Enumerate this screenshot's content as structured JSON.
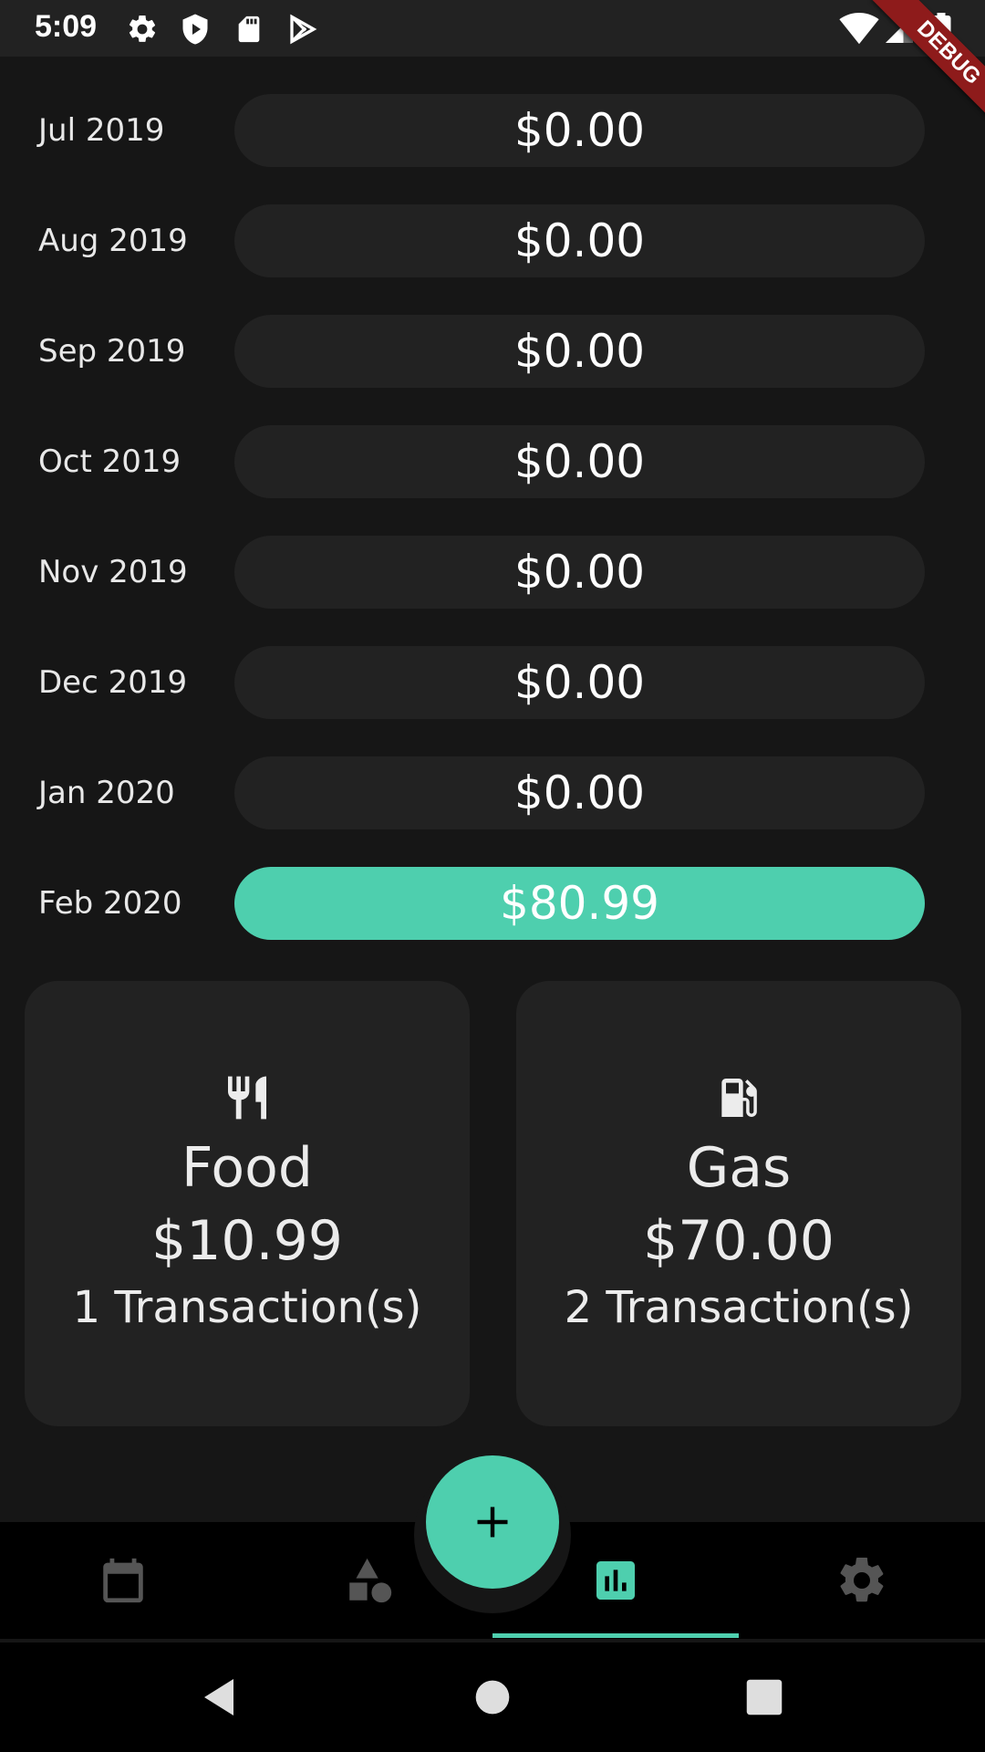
{
  "status_bar": {
    "time": "5:09",
    "left_icons": [
      "settings-icon",
      "shield-icon",
      "sd-card-icon",
      "play-store-icon"
    ],
    "right_icons": [
      "wifi-icon",
      "signal-icon",
      "battery-icon"
    ]
  },
  "debug_banner": {
    "text": "DEBUG"
  },
  "months": [
    {
      "label": "Jul 2019",
      "amount": "$0.00",
      "active": false
    },
    {
      "label": "Aug 2019",
      "amount": "$0.00",
      "active": false
    },
    {
      "label": "Sep 2019",
      "amount": "$0.00",
      "active": false
    },
    {
      "label": "Oct 2019",
      "amount": "$0.00",
      "active": false
    },
    {
      "label": "Nov 2019",
      "amount": "$0.00",
      "active": false
    },
    {
      "label": "Dec 2019",
      "amount": "$0.00",
      "active": false
    },
    {
      "label": "Jan 2020",
      "amount": "$0.00",
      "active": false
    },
    {
      "label": "Feb 2020",
      "amount": "$80.99",
      "active": true
    }
  ],
  "categories": [
    {
      "icon": "utensils-icon",
      "name": "Food",
      "amount": "$10.99",
      "count": "1 Transaction(s)"
    },
    {
      "icon": "gas-station-icon",
      "name": "Gas",
      "amount": "$70.00",
      "count": "2 Transaction(s)"
    }
  ],
  "fab": {
    "icon": "plus-icon"
  },
  "bottom_nav": {
    "items": [
      {
        "icon": "calendar-icon",
        "selected": false
      },
      {
        "icon": "categories-icon",
        "selected": false
      },
      {
        "icon": "chart-icon",
        "selected": true
      },
      {
        "icon": "settings-icon",
        "selected": false
      }
    ]
  },
  "system_nav": {
    "items": [
      "back-icon",
      "home-icon",
      "recents-icon"
    ]
  },
  "colors": {
    "accent": "#4ecfae",
    "background": "#161616",
    "surface": "#222222",
    "nav_bg": "#000000",
    "ribbon": "#8e1b1b",
    "inactive_icon": "#555555"
  }
}
